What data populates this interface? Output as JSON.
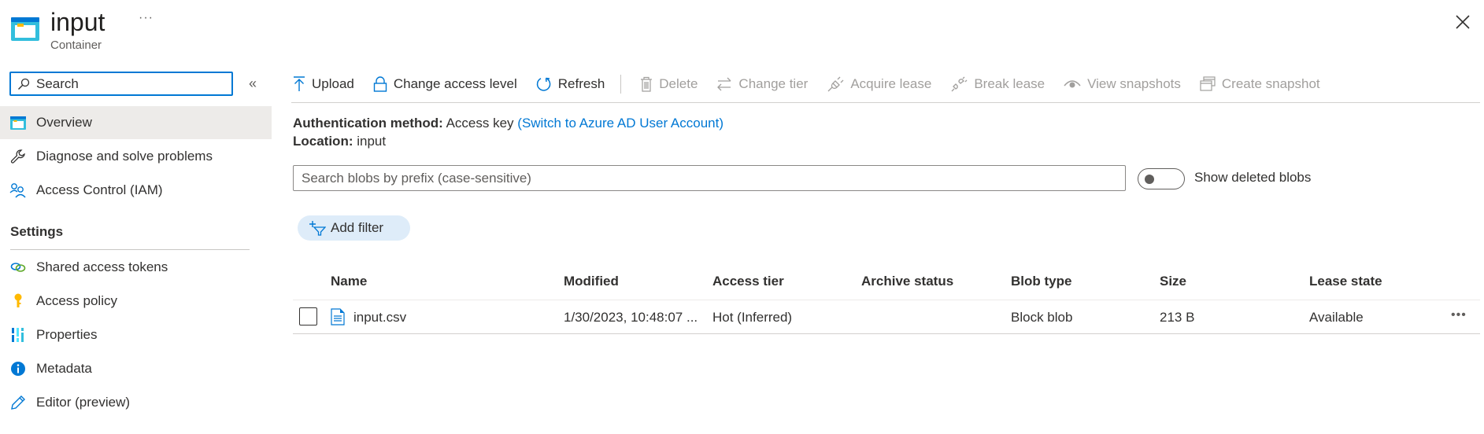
{
  "header": {
    "title": "input",
    "subtitle": "Container",
    "more_label": "···",
    "container_icon": "container-icon",
    "close_icon": "close-icon"
  },
  "sidebar": {
    "search_placeholder": "Search",
    "collapse_label": "«",
    "items": [
      {
        "label": "Overview",
        "icon": "container-icon",
        "active": true
      },
      {
        "label": "Diagnose and solve problems",
        "icon": "wrench-icon"
      },
      {
        "label": "Access Control (IAM)",
        "icon": "people-icon"
      }
    ],
    "settings_section": {
      "label": "Settings",
      "items": [
        {
          "label": "Shared access tokens",
          "icon": "link-icon"
        },
        {
          "label": "Access policy",
          "icon": "key-icon"
        },
        {
          "label": "Properties",
          "icon": "properties-icon"
        },
        {
          "label": "Metadata",
          "icon": "info-icon"
        },
        {
          "label": "Editor (preview)",
          "icon": "pencil-icon"
        }
      ]
    }
  },
  "toolbar": {
    "upload": "Upload",
    "change_access_level": "Change access level",
    "refresh": "Refresh",
    "delete": "Delete",
    "change_tier": "Change tier",
    "acquire_lease": "Acquire lease",
    "break_lease": "Break lease",
    "view_snapshots": "View snapshots",
    "create_snapshot": "Create snapshot"
  },
  "info": {
    "auth_label": "Authentication method:",
    "auth_value": "Access key",
    "auth_link": "(Switch to Azure AD User Account)",
    "location_label": "Location:",
    "location_value": "input"
  },
  "blob_search": {
    "placeholder": "Search blobs by prefix (case-sensitive)",
    "value": ""
  },
  "show_deleted": {
    "label": "Show deleted blobs",
    "on": false
  },
  "add_filter_label": "Add filter",
  "table": {
    "columns": [
      "Name",
      "Modified",
      "Access tier",
      "Archive status",
      "Blob type",
      "Size",
      "Lease state"
    ],
    "rows": [
      {
        "name": "input.csv",
        "modified": "1/30/2023, 10:48:07 ...",
        "access_tier": "Hot (Inferred)",
        "archive_status": "",
        "blob_type": "Block blob",
        "size": "213 B",
        "lease_state": "Available",
        "selected": false
      }
    ],
    "row_more_label": "•••"
  },
  "colors": {
    "accent": "#0078d4",
    "active_nav_bg": "#edebe9",
    "filter_pill_bg": "#deecf9",
    "disabled_text": "#a19f9d"
  }
}
